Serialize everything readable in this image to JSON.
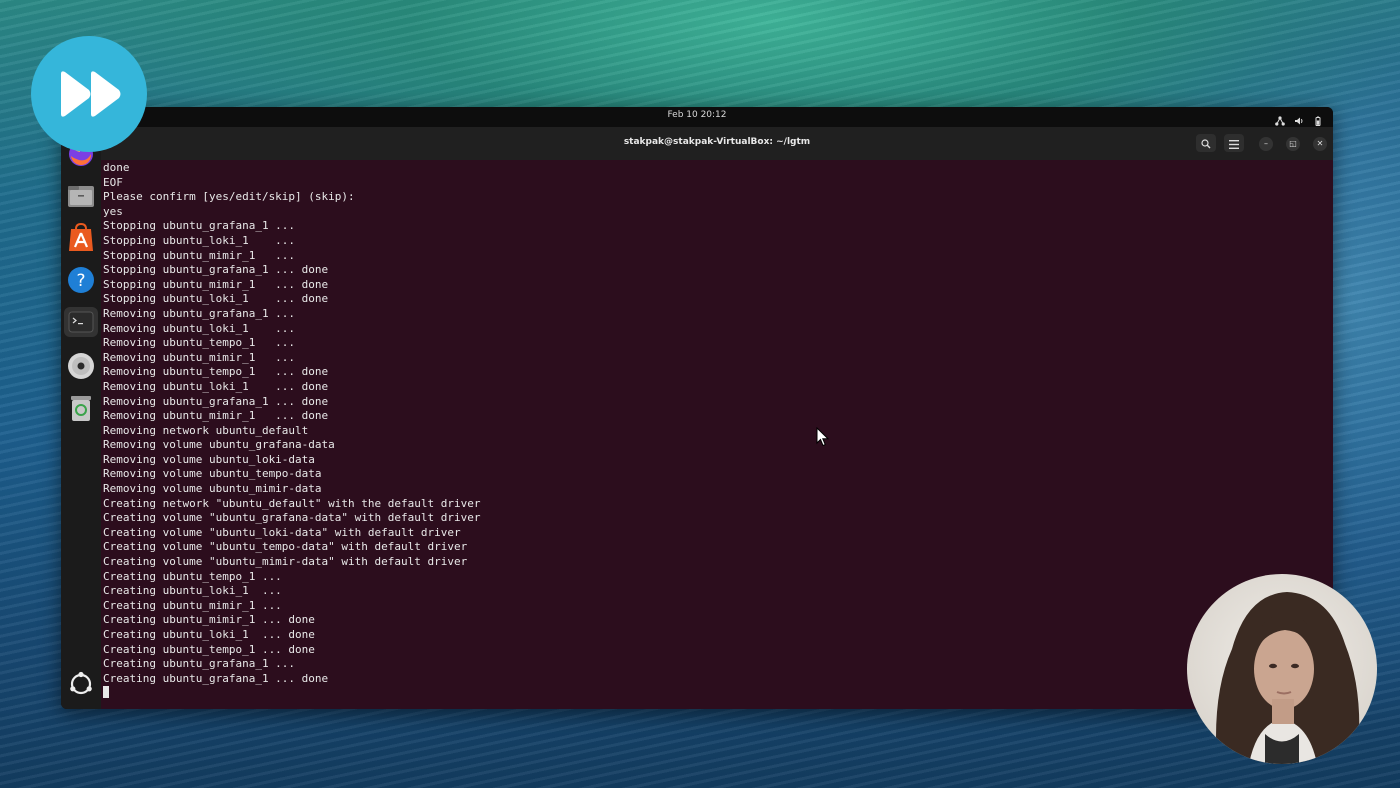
{
  "topbar": {
    "clock": "Feb 10  20:12"
  },
  "terminal": {
    "title": "stakpak@stakpak-VirtualBox: ~/lgtm",
    "lines": [
      "done",
      "EOF",
      "Please confirm [yes/edit/skip] (skip):",
      "yes",
      "Stopping ubuntu_grafana_1 ...",
      "Stopping ubuntu_loki_1    ...",
      "Stopping ubuntu_mimir_1   ...",
      "Stopping ubuntu_grafana_1 ... done",
      "Stopping ubuntu_mimir_1   ... done",
      "Stopping ubuntu_loki_1    ... done",
      "Removing ubuntu_grafana_1 ...",
      "Removing ubuntu_loki_1    ...",
      "Removing ubuntu_tempo_1   ...",
      "Removing ubuntu_mimir_1   ...",
      "Removing ubuntu_tempo_1   ... done",
      "Removing ubuntu_loki_1    ... done",
      "Removing ubuntu_grafana_1 ... done",
      "Removing ubuntu_mimir_1   ... done",
      "Removing network ubuntu_default",
      "Removing volume ubuntu_grafana-data",
      "Removing volume ubuntu_loki-data",
      "Removing volume ubuntu_tempo-data",
      "Removing volume ubuntu_mimir-data",
      "Creating network \"ubuntu_default\" with the default driver",
      "Creating volume \"ubuntu_grafana-data\" with default driver",
      "Creating volume \"ubuntu_loki-data\" with default driver",
      "Creating volume \"ubuntu_tempo-data\" with default driver",
      "Creating volume \"ubuntu_mimir-data\" with default driver",
      "Creating ubuntu_tempo_1 ...",
      "Creating ubuntu_loki_1  ...",
      "Creating ubuntu_mimir_1 ...",
      "Creating ubuntu_mimir_1 ... done",
      "Creating ubuntu_loki_1  ... done",
      "Creating ubuntu_tempo_1 ... done",
      "Creating ubuntu_grafana_1 ...",
      "Creating ubuntu_grafana_1 ... done"
    ]
  },
  "dock": {
    "icons": [
      "firefox-icon",
      "files-icon",
      "app-center-icon",
      "help-icon",
      "terminal-icon",
      "disc-icon",
      "trash-icon",
      "show-apps-icon"
    ]
  },
  "colors": {
    "terminal_bg": "#2c0d1d",
    "terminal_fg": "#e8e8e8",
    "badge": "#35b6da"
  }
}
